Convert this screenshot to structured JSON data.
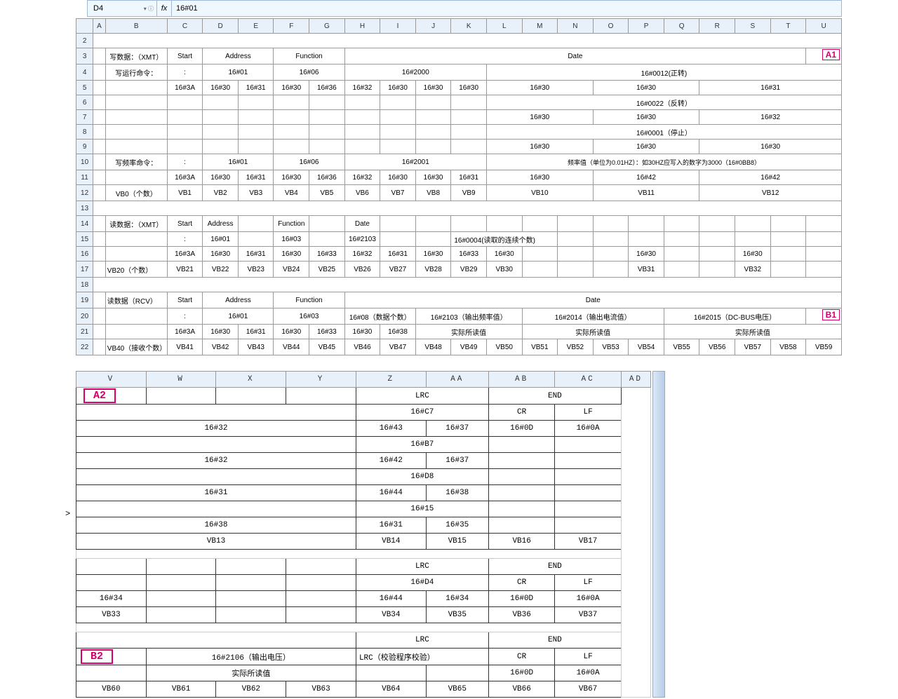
{
  "formula": {
    "cellref": "D4",
    "fx": "fx",
    "value": "16#01"
  },
  "cols1": [
    "",
    "A",
    "B",
    "C",
    "D",
    "E",
    "F",
    "G",
    "H",
    "I",
    "J",
    "K",
    "L",
    "M",
    "N",
    "O",
    "P",
    "Q",
    "R",
    "S",
    "T",
    "U"
  ],
  "rows1hdr": [
    "2",
    "3",
    "4",
    "5",
    "6",
    "7",
    "8",
    "9",
    "10",
    "11",
    "12",
    "13",
    "14",
    "15",
    "16",
    "17",
    "18",
    "19",
    "20",
    "21",
    "22"
  ],
  "r3": {
    "b": "写数据：（XMT）",
    "c": "Start",
    "de": "Address",
    "fg": "Function",
    "date": "Date",
    "mark": "A1"
  },
  "r4": {
    "b": "写运行命令：",
    "c": ":",
    "de": "16#01",
    "fg": "16#06",
    "h_k": "16#2000",
    "rest": "16#0012(正转)"
  },
  "r5": {
    "c": "16#3A",
    "d": "16#30",
    "e": "16#31",
    "f": "16#30",
    "g": "16#36",
    "h": "16#32",
    "i": "16#30",
    "j": "16#30",
    "k": "16#30",
    "l_n": "16#30",
    "o_q": "16#30",
    "r_u": "16#31"
  },
  "r6": {
    "rest": "16#0022（反转）"
  },
  "r7": {
    "l_n": "16#30",
    "o_q": "16#30",
    "r_u": "16#32"
  },
  "r8": {
    "rest": "16#0001（停止）"
  },
  "r9": {
    "l_n": "16#30",
    "o_q": "16#30",
    "r_u": "16#30"
  },
  "r10": {
    "b": "写频率命令：",
    "c": ":",
    "de": "16#01",
    "fg": "16#06",
    "h_k": "16#2001",
    "rest": "频率值（单位为0.01HZ）：如30HZ应写入的数字为3000（16#0BB8）"
  },
  "r11": {
    "c": "16#3A",
    "d": "16#30",
    "e": "16#31",
    "f": "16#30",
    "g": "16#36",
    "h": "16#32",
    "i": "16#30",
    "j": "16#30",
    "k": "16#31",
    "l_n": "16#30",
    "o_q": "16#42",
    "r_u": "16#42"
  },
  "r12": {
    "b": "VB0（个数）",
    "c": "VB1",
    "d": "VB2",
    "e": "VB3",
    "f": "VB4",
    "g": "VB5",
    "h": "VB6",
    "i": "VB7",
    "j": "VB8",
    "k": "VB9",
    "l_n": "VB10",
    "o_q": "VB11",
    "r_u": "VB12"
  },
  "r14": {
    "b": "读数据：（XMT）",
    "c": "Start",
    "d": "Address",
    "f": "Function",
    "h": "Date"
  },
  "r15": {
    "c": ":",
    "d": "16#01",
    "f": "16#03",
    "h": "16#2103",
    "kl": "16#0004(读取的连续个数)"
  },
  "r16": {
    "c": "16#3A",
    "d": "16#30",
    "e": "16#31",
    "f": "16#30",
    "g": "16#33",
    "h": "16#32",
    "i": "16#31",
    "j": "16#30",
    "k": "16#33",
    "l": "16#30",
    "p": "16#30",
    "s": "16#30"
  },
  "r17": {
    "b": "VB20（个数）",
    "c": "VB21",
    "d": "VB22",
    "e": "VB23",
    "f": "VB24",
    "g": "VB25",
    "h": "VB26",
    "i": "VB27",
    "j": "VB28",
    "k": "VB29",
    "l": "VB30",
    "p": "VB31",
    "s": "VB32"
  },
  "r19": {
    "b": "读数据（RCV）",
    "c": "Start",
    "de": "Address",
    "fg": "Function",
    "date": "Date"
  },
  "r20": {
    "c": ":",
    "de": "16#01",
    "fg": "16#03",
    "hi": "16#08（数据个数）",
    "jl": "16#2103（输出频率值）",
    "mp": "16#2014（输出电流值）",
    "qu": "16#2015（DC-BUS电压）",
    "mark": "B1"
  },
  "r21": {
    "c": "16#3A",
    "d": "16#30",
    "e": "16#31",
    "f": "16#30",
    "g": "16#33",
    "h": "16#30",
    "i": "16#38",
    "jl": "实际所读值",
    "mp": "实际所读值",
    "qu": "实际所读值"
  },
  "r22": {
    "b": "VB40（接收个数）",
    "c": "VB41",
    "d": "VB42",
    "e": "VB43",
    "f": "VB44",
    "g": "VB45",
    "h": "VB46",
    "i": "VB47",
    "j": "VB48",
    "k": "VB49",
    "l": "VB50",
    "m": "VB51",
    "n": "VB52",
    "o": "VB53",
    "p": "VB54",
    "q": "VB55",
    "r": "VB56",
    "s": "VB57",
    "t": "VB58",
    "u": "VB59"
  },
  "cols2": [
    "V",
    "W",
    "X",
    "Y",
    "Z",
    "AA",
    "AB",
    "AC",
    "AD"
  ],
  "sec2": {
    "mark_a2": "A2",
    "lrc": "LRC",
    "end": "END",
    "r2": {
      "za": "16#C7",
      "ab": "CR",
      "ac": "LF"
    },
    "r3": {
      "vwxy": "16#32",
      "z": "16#43",
      "aa": "16#37",
      "ab": "16#0D",
      "ac": "16#0A"
    },
    "r4": {
      "za": "16#B7"
    },
    "r5": {
      "vwxy": "16#32",
      "z": "16#42",
      "aa": "16#37"
    },
    "r6": {
      "za": "16#D8"
    },
    "r7": {
      "vwxy": "16#31",
      "z": "16#44",
      "aa": "16#38"
    },
    "r8arrow": ">",
    "r8": {
      "za": "16#15"
    },
    "r9": {
      "vwxy": "16#38",
      "z": "16#31",
      "aa": "16#35"
    },
    "r10": {
      "vwxy": "VB13",
      "z": "VB14",
      "aa": "VB15",
      "ab": "VB16",
      "ac": "VB17"
    },
    "r12": {
      "z": "LRC",
      "ab": "END"
    },
    "r13": {
      "za": "16#D4",
      "ab": "CR",
      "ac": "LF"
    },
    "r14": {
      "v": "16#34",
      "z": "16#44",
      "aa": "16#34",
      "ab": "16#0D",
      "ac": "16#0A"
    },
    "r15": {
      "v": "VB33",
      "z": "VB34",
      "aa": "VB35",
      "ab": "VB36",
      "ac": "VB37"
    },
    "r17": {
      "za": "LRC",
      "abac": "END"
    },
    "mark_b2": "B2",
    "r18": {
      "wxy": "16#2106（输出电压）",
      "za": "LRC（校验程序校验）",
      "ab": "CR",
      "ac": "LF"
    },
    "r19": {
      "wxy": "实际所读值",
      "ab": "16#0D",
      "ac": "16#0A"
    },
    "r20": {
      "v": "VB60",
      "w": "VB61",
      "x": "VB62",
      "y": "VB63",
      "z": "VB64",
      "aa": "VB65",
      "ab": "VB66",
      "ac": "VB67"
    }
  }
}
